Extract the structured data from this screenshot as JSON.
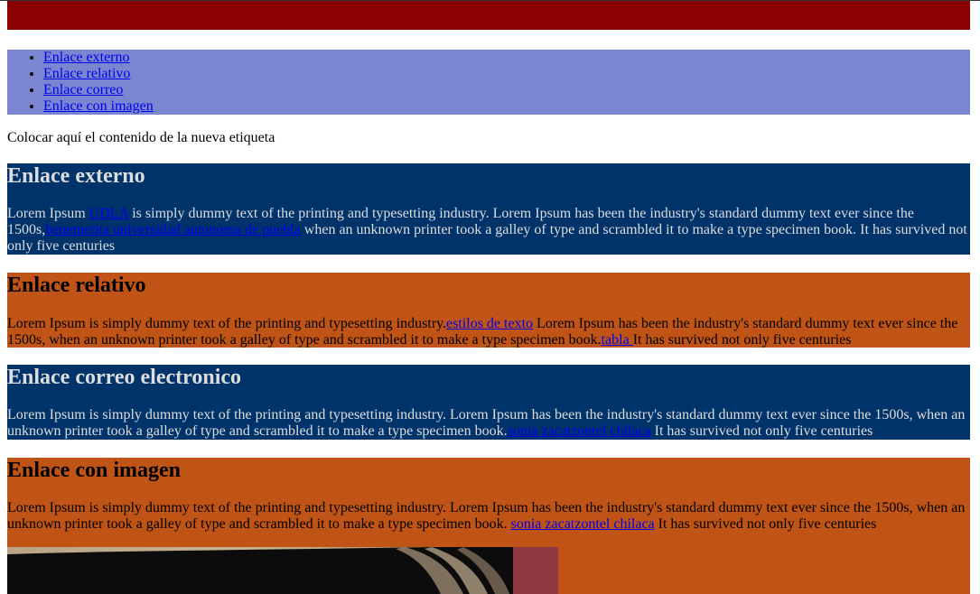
{
  "nav": {
    "items": [
      "Enlace externo",
      "Enlace relativo",
      "Enlace correo",
      "Enlace con imagen"
    ]
  },
  "intro": "Colocar aquí el contenido de la nueva etiqueta",
  "sections": [
    {
      "title": "Enlace externo",
      "t1": "Lorem Ipsum ",
      "l1": "UDLA",
      "t2": " is simply dummy text of the printing and typesetting industry. Lorem Ipsum has been the industry's standard dummy text ever since the 1500s,",
      "l2": "benemerita universidad autonoma de puebla",
      "t3": " when an unknown printer took a galley of type and scrambled it to make a type specimen book. It has survived not only five centuries"
    },
    {
      "title": "Enlace relativo",
      "t1": "Lorem Ipsum is simply dummy text of the printing and typesetting industry.",
      "l1": "estilos de texto",
      "t2": " Lorem Ipsum has been the industry's standard dummy text ever since the 1500s, when an unknown printer took a galley of type and scrambled it to make a type specimen book.",
      "l2": "tabla ",
      "t3": "It has survived not only five centuries"
    },
    {
      "title": "Enlace correo electronico",
      "t1": "Lorem Ipsum is simply dummy text of the printing and typesetting industry. Lorem Ipsum has been the industry's standard dummy text ever since the 1500s, when an unknown printer took a galley of type and scrambled it to make a type specimen book.",
      "l1": "sonia zacatzontel chilaca",
      "t2": " It has survived not only five centuries"
    },
    {
      "title": "Enlace con imagen",
      "t1": "Lorem Ipsum is simply dummy text of the printing and typesetting industry. Lorem Ipsum has been the industry's standard dummy text ever since the 1500s, when an unknown printer took a galley of type and scrambled it to make a type specimen book. ",
      "l1": "sonia zacatzontel chilaca",
      "t2": " It has survived not only five centuries"
    }
  ],
  "colors": {
    "header": "#8b0000",
    "nav": "#7a87d0",
    "section_blue": "#00336a",
    "section_orange": "#bf5416",
    "link": "#0000ee"
  }
}
